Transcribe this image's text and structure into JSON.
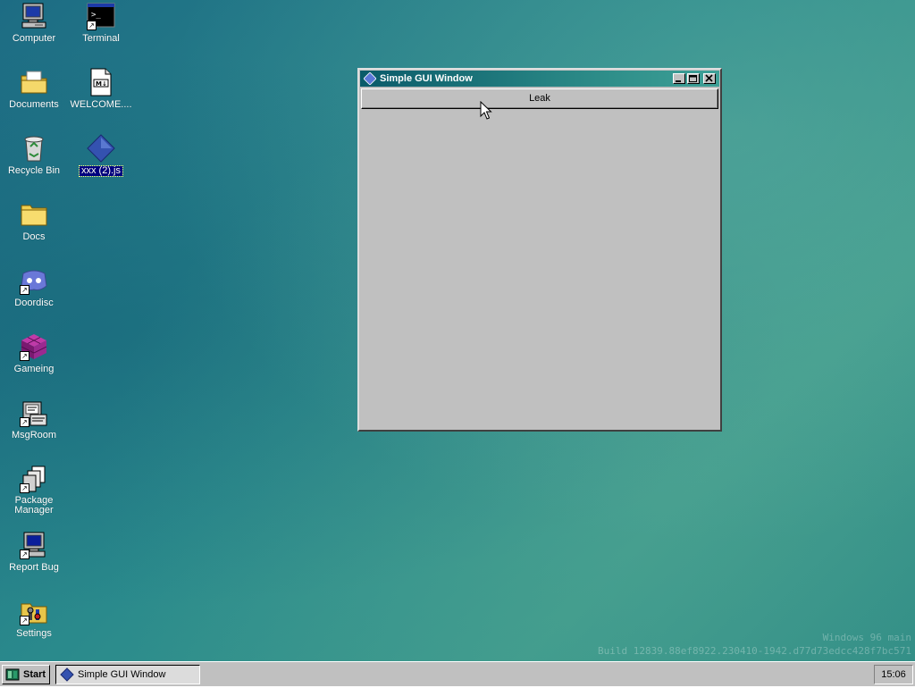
{
  "desktop": {
    "icons": [
      {
        "label": "Computer",
        "icon": "computer-icon",
        "shortcut": false
      },
      {
        "label": "Terminal",
        "icon": "terminal-icon",
        "shortcut": true
      },
      {
        "label": "Documents",
        "icon": "documents-folder-icon",
        "shortcut": false
      },
      {
        "label": "WELCOME....",
        "icon": "markdown-file-icon",
        "shortcut": false
      },
      {
        "label": "Recycle Bin",
        "icon": "recycle-bin-icon",
        "shortcut": false
      },
      {
        "label": "xxx (2).js",
        "icon": "script-diamond-icon",
        "shortcut": false,
        "selected": true
      },
      {
        "label": "Docs",
        "icon": "folder-icon",
        "shortcut": false
      },
      {
        "label": "Doordisc",
        "icon": "doordisc-icon",
        "shortcut": true
      },
      {
        "label": "Gameing",
        "icon": "game-cube-icon",
        "shortcut": true
      },
      {
        "label": "MsgRoom",
        "icon": "msgroom-icon",
        "shortcut": true
      },
      {
        "label": "Package Manager",
        "icon": "package-manager-icon",
        "shortcut": true
      },
      {
        "label": "Report Bug",
        "icon": "report-bug-icon",
        "shortcut": true
      },
      {
        "label": "Settings",
        "icon": "settings-icon",
        "shortcut": true
      }
    ]
  },
  "window": {
    "title": "Simple GUI Window",
    "icon": "diamond-icon",
    "buttons": {
      "minimize": "minimize-icon",
      "maximize": "maximize-icon",
      "close": "close-icon"
    },
    "leak_button": "Leak"
  },
  "watermark": {
    "line1": "Windows 96 main",
    "line2": "Build 12839.88ef8922.230410-1942.d77d73edcc428f7bc571"
  },
  "taskbar": {
    "start_label": "Start",
    "task_label": "Simple GUI Window",
    "clock": "15:06"
  },
  "colors": {
    "window_face": "#c0c0c0",
    "titlebar_start": "#0a5b6a",
    "titlebar_end": "#3ea097",
    "selection": "#000080"
  }
}
